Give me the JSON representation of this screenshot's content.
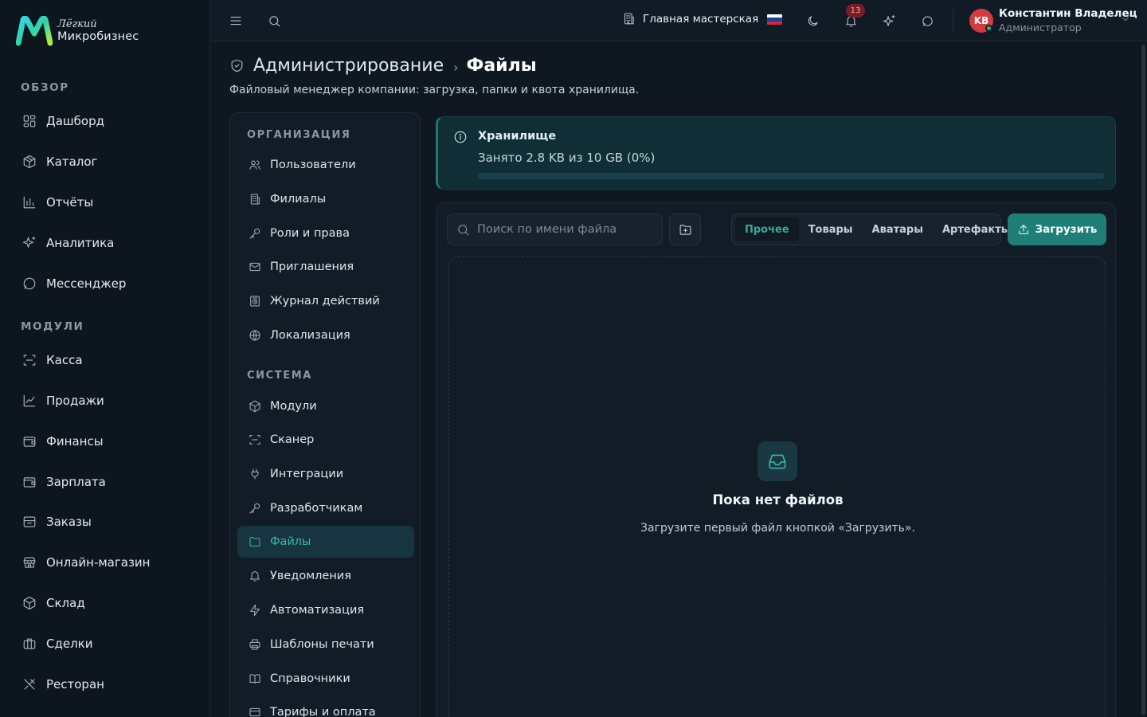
{
  "brand": {
    "top": "Лёгкий",
    "bottom": "Микробизнес"
  },
  "sidebar": {
    "sections": [
      {
        "title": "ОБЗОР",
        "items": [
          {
            "label": "Дашборд",
            "icon": "dashboard-icon"
          },
          {
            "label": "Каталог",
            "icon": "catalog-icon"
          },
          {
            "label": "Отчёты",
            "icon": "reports-icon"
          },
          {
            "label": "Аналитика",
            "icon": "sparkles-icon"
          },
          {
            "label": "Мессенджер",
            "icon": "chat-icon"
          }
        ]
      },
      {
        "title": "МОДУЛИ",
        "items": [
          {
            "label": "Касса",
            "icon": "scan-icon"
          },
          {
            "label": "Продажи",
            "icon": "trend-icon"
          },
          {
            "label": "Финансы",
            "icon": "wallet-icon"
          },
          {
            "label": "Зарплата",
            "icon": "wallet-icon"
          },
          {
            "label": "Заказы",
            "icon": "inbox-icon"
          },
          {
            "label": "Онлайн-магазин",
            "icon": "store-icon"
          },
          {
            "label": "Склад",
            "icon": "box-icon"
          },
          {
            "label": "Сделки",
            "icon": "briefcase-icon"
          },
          {
            "label": "Ресторан",
            "icon": "utensils-icon"
          }
        ]
      }
    ]
  },
  "topbar": {
    "workshop": "Главная мастерская",
    "notifications_count": "13",
    "user": {
      "initials": "KB",
      "name": "Константин Владелец",
      "role": "Администратор"
    },
    "flag_colors": [
      "#ffffff",
      "#1c3fa0",
      "#d7262e"
    ]
  },
  "header": {
    "breadcrumb_parent": "Администрирование",
    "breadcrumb_separator": "›",
    "breadcrumb_current": "Файлы",
    "subtitle": "Файловый менеджер компании: загрузка, папки и квота хранилища."
  },
  "admin_nav": {
    "sections": [
      {
        "title": "ОРГАНИЗАЦИЯ",
        "items": [
          {
            "label": "Пользователи",
            "icon": "users-icon"
          },
          {
            "label": "Филиалы",
            "icon": "building-icon"
          },
          {
            "label": "Роли и права",
            "icon": "key-icon"
          },
          {
            "label": "Приглашения",
            "icon": "mail-icon"
          },
          {
            "label": "Журнал действий",
            "icon": "history-icon"
          },
          {
            "label": "Локализация",
            "icon": "globe-icon"
          }
        ]
      },
      {
        "title": "СИСТЕМА",
        "items": [
          {
            "label": "Модули",
            "icon": "box-icon"
          },
          {
            "label": "Сканер",
            "icon": "scan-icon"
          },
          {
            "label": "Интеграции",
            "icon": "plug-icon"
          },
          {
            "label": "Разработчикам",
            "icon": "key-icon"
          },
          {
            "label": "Файлы",
            "icon": "folder-icon",
            "active": true
          },
          {
            "label": "Уведомления",
            "icon": "bell-icon"
          },
          {
            "label": "Автоматизация",
            "icon": "zap-icon"
          },
          {
            "label": "Шаблоны печати",
            "icon": "printer-icon"
          },
          {
            "label": "Справочники",
            "icon": "book-icon"
          },
          {
            "label": "Тарифы и оплата",
            "icon": "card-icon"
          }
        ]
      }
    ]
  },
  "storage": {
    "title": "Хранилище",
    "usage_text": "Занято 2.8 KB из 10 GB (0%)",
    "used_percent": 0
  },
  "files": {
    "search_placeholder": "Поиск по имени файла",
    "tabs": [
      "Прочее",
      "Товары",
      "Аватары",
      "Артефакты"
    ],
    "active_tab": 0,
    "upload_label": "Загрузить",
    "empty_title": "Пока нет файлов",
    "empty_text": "Загрузите первый файл кнопкой «Загрузить»."
  },
  "colors": {
    "accent": "#1f7f78",
    "accent_text": "#36a99b",
    "background": "#0f1821"
  }
}
